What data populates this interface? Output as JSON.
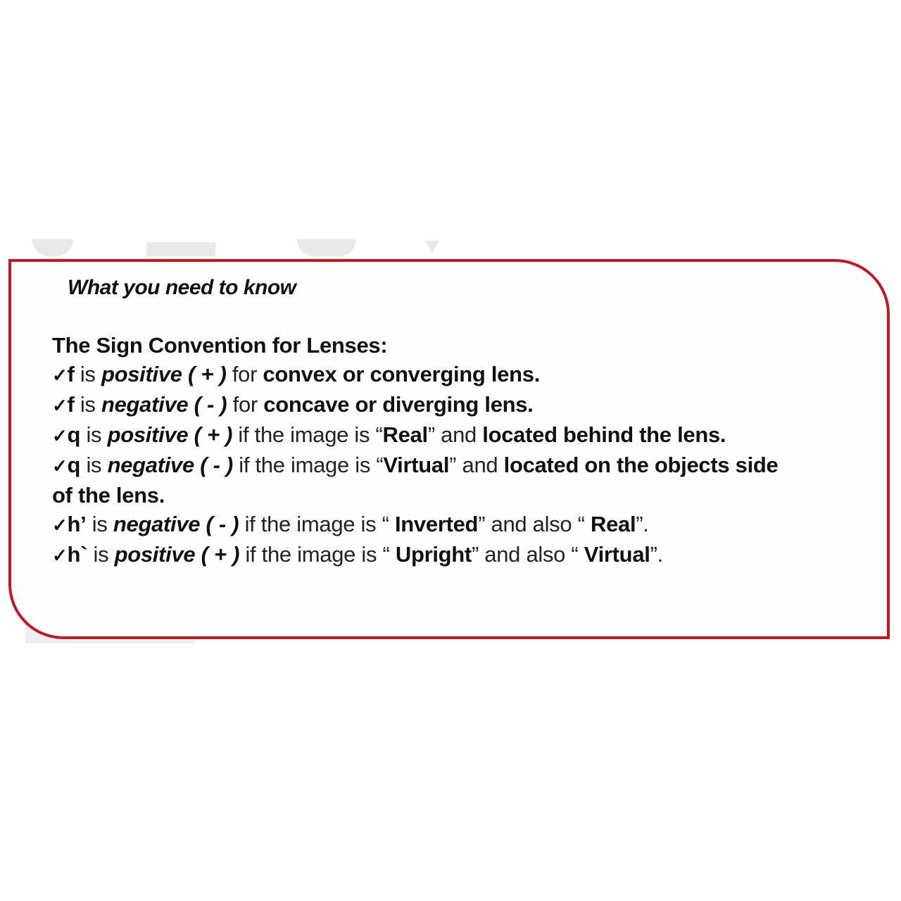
{
  "card": {
    "subtitle": "What you need to know",
    "heading": "The Sign Convention for Lenses:",
    "check_glyph": "✓",
    "rows": [
      {
        "sym": "f",
        "is": " is ",
        "sign": "positive ( + )",
        "mid": " for ",
        "rest": "convex or converging lens."
      },
      {
        "sym": "f",
        "is": " is ",
        "sign": "negative ( - )",
        "mid": " for ",
        "rest": "concave or diverging lens."
      },
      {
        "sym": "q",
        "is": " is ",
        "sign": "positive ( + )",
        "mid": " if the image is “",
        "type": "Real",
        "and": "” and  ",
        "rest": "located behind  the lens."
      },
      {
        "sym": "q",
        "is": " is ",
        "sign": "negative ( - )",
        "mid": " if the image is “",
        "type": "Virtual",
        "and": "” and  ",
        "rest": "located on the objects side",
        "cont": "of the lens."
      },
      {
        "sym": "h’",
        "is": " is ",
        "sign": "negative ( - )",
        "mid": " if the image is “ ",
        "type": "Inverted",
        "and": "” and also “ ",
        "type2": "Real",
        "end": "”."
      },
      {
        "sym": "h`",
        "is": " is ",
        "sign": "positive ( + )",
        "mid": " if the image is “ ",
        "type": "Upright",
        "and": "” and also “ ",
        "type2": "Virtual",
        "end": "”."
      }
    ]
  },
  "colors": {
    "border": "#c4161c",
    "text": "#111111"
  }
}
